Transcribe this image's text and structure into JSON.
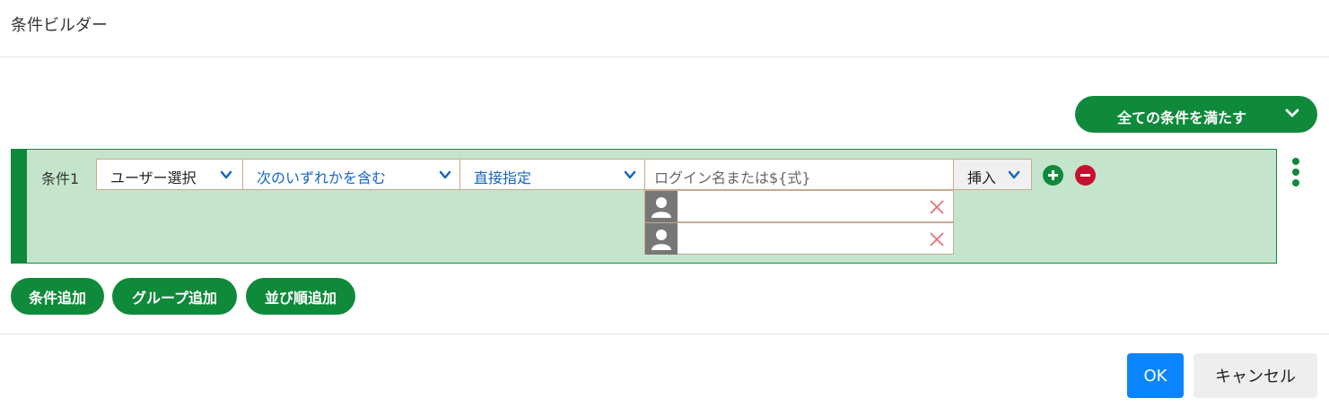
{
  "dialog": {
    "title": "条件ビルダー"
  },
  "match_mode": {
    "label": "全ての条件を満たす",
    "icon": "chevron-down-icon"
  },
  "condition": {
    "label": "条件1",
    "user_select": {
      "value": "ユーザー選択",
      "icon": "chevron-down-icon"
    },
    "operator": {
      "value": "次のいずれかを含む",
      "icon": "chevron-down-icon"
    },
    "value_mode": {
      "value": "直接指定",
      "icon": "chevron-down-icon"
    },
    "input": {
      "placeholder": "ログイン名または${式}"
    },
    "insert": {
      "label": "挿入",
      "icon": "chevron-down-icon"
    },
    "selected_users": [
      {
        "name": "",
        "icon": "person-icon",
        "remove_icon": "close-icon"
      },
      {
        "name": "",
        "icon": "person-icon",
        "remove_icon": "close-icon"
      }
    ]
  },
  "actions": {
    "add_condition": "条件追加",
    "add_group": "グループ追加",
    "add_sort": "並び順追加"
  },
  "footer": {
    "ok": "OK",
    "cancel": "キャンセル"
  },
  "colors": {
    "brand_green": "#0f8a3a",
    "condition_bg": "#c4e5cc",
    "remove_red": "#c8102e",
    "ok_blue": "#0b84ff",
    "select_text_blue": "#1565c0"
  }
}
